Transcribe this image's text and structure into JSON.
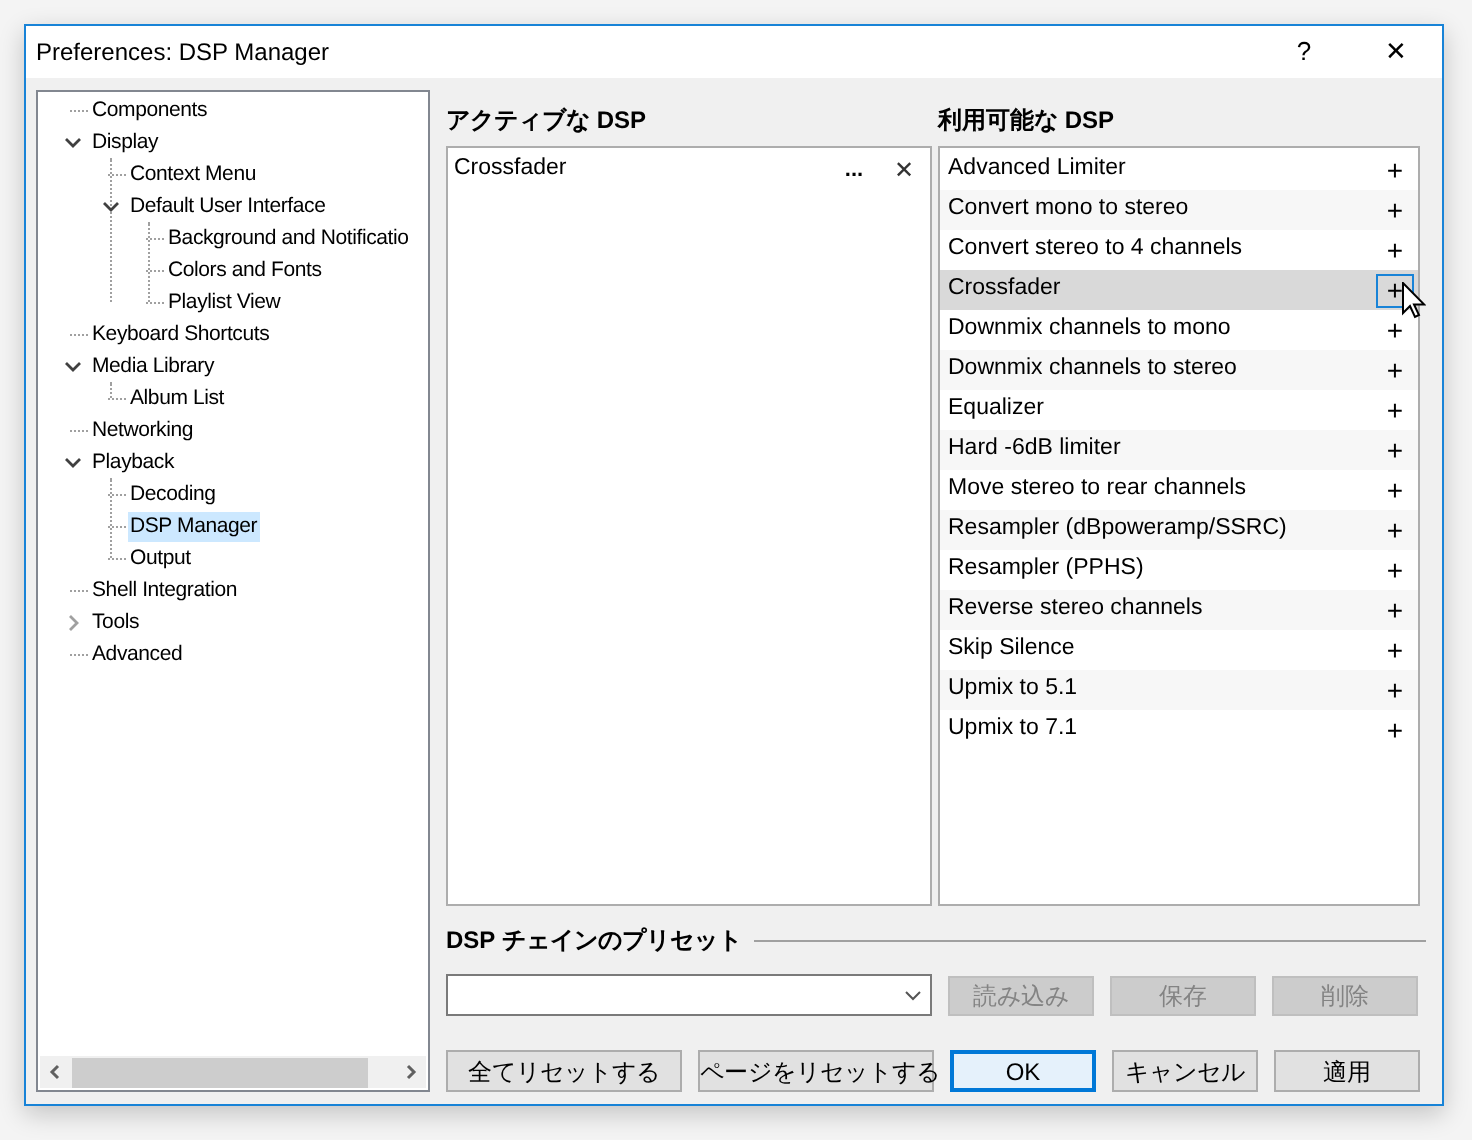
{
  "window": {
    "title": "Preferences: DSP Manager",
    "buttons": [
      "?",
      "✕"
    ]
  },
  "tree": [
    {
      "label": "Components",
      "selected": false
    },
    {
      "label": "Display",
      "selected": false,
      "expanded": true,
      "children": [
        {
          "label": "Context Menu",
          "selected": false
        },
        {
          "label": "Default User Interface",
          "selected": false,
          "expanded": true,
          "children": [
            {
              "label": "Background and Notificatio",
              "selected": false
            },
            {
              "label": "Colors and Fonts",
              "selected": false
            },
            {
              "label": "Playlist View",
              "selected": false
            }
          ]
        }
      ]
    },
    {
      "label": "Keyboard Shortcuts",
      "selected": false
    },
    {
      "label": "Media Library",
      "selected": false,
      "expanded": true,
      "children": [
        {
          "label": "Album List",
          "selected": false
        }
      ]
    },
    {
      "label": "Networking",
      "selected": false
    },
    {
      "label": "Playback",
      "selected": false,
      "expanded": true,
      "children": [
        {
          "label": "Decoding",
          "selected": false
        },
        {
          "label": "DSP Manager",
          "selected": true
        },
        {
          "label": "Output",
          "selected": false
        }
      ]
    },
    {
      "label": "Shell Integration",
      "selected": false
    },
    {
      "label": "Tools",
      "selected": false,
      "expanded": false
    },
    {
      "label": "Advanced",
      "selected": false
    }
  ],
  "active_dsp": {
    "heading": "アクティブな DSP",
    "items": [
      {
        "name": "Crossfader",
        "configure": "...",
        "remove": "✕"
      }
    ]
  },
  "available_dsp": {
    "heading": "利用可能な DSP",
    "items": [
      {
        "name": "Advanced Limiter",
        "add": "+",
        "selected": false
      },
      {
        "name": "Convert mono to stereo",
        "add": "+",
        "selected": false
      },
      {
        "name": "Convert stereo to 4 channels",
        "add": "+",
        "selected": false
      },
      {
        "name": "Crossfader",
        "add": "+",
        "selected": true
      },
      {
        "name": "Downmix channels to mono",
        "add": "+",
        "selected": false
      },
      {
        "name": "Downmix channels to stereo",
        "add": "+",
        "selected": false
      },
      {
        "name": "Equalizer",
        "add": "+",
        "selected": false
      },
      {
        "name": "Hard -6dB limiter",
        "add": "+",
        "selected": false
      },
      {
        "name": "Move stereo to rear channels",
        "add": "+",
        "selected": false
      },
      {
        "name": "Resampler (dBpoweramp/SSRC)",
        "add": "+",
        "selected": false
      },
      {
        "name": "Resampler (PPHS)",
        "add": "+",
        "selected": false
      },
      {
        "name": "Reverse stereo channels",
        "add": "+",
        "selected": false
      },
      {
        "name": "Skip Silence",
        "add": "+",
        "selected": false
      },
      {
        "name": "Upmix to 5.1",
        "add": "+",
        "selected": false
      },
      {
        "name": "Upmix to 7.1",
        "add": "+",
        "selected": false
      }
    ]
  },
  "presets": {
    "heading": "DSP チェインのプリセット",
    "buttons": [
      {
        "label": "読み込み",
        "disabled": true
      },
      {
        "label": "保存",
        "disabled": true
      },
      {
        "label": "削除",
        "disabled": true
      }
    ]
  },
  "footer_buttons": [
    {
      "label": "全てリセットする",
      "default": false
    },
    {
      "label": "ページをリセットする",
      "default": false
    },
    {
      "label": "OK",
      "default": true
    },
    {
      "label": "キャンセル",
      "default": false
    },
    {
      "label": "適用",
      "default": false
    }
  ]
}
